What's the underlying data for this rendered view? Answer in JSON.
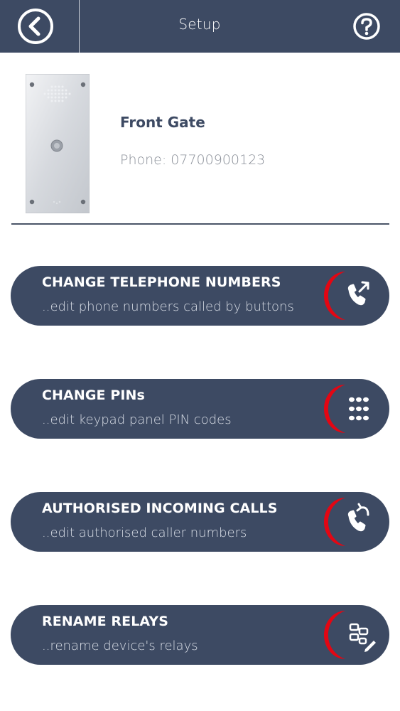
{
  "header": {
    "title": "Setup"
  },
  "device": {
    "name": "Front Gate",
    "phone": "Phone: 07700900123"
  },
  "menu": [
    {
      "title": "CHANGE TELEPHONE NUMBERS",
      "subtitle": "..edit phone numbers called by buttons",
      "icon": "phone-forward-icon"
    },
    {
      "title": "CHANGE PINs",
      "subtitle": "..edit keypad panel PIN codes",
      "icon": "keypad-icon"
    },
    {
      "title": "AUTHORISED INCOMING CALLS",
      "subtitle": "..edit authorised caller numbers",
      "icon": "phone-incoming-icon"
    },
    {
      "title": "RENAME RELAYS",
      "subtitle": "..rename device's relays",
      "icon": "relay-edit-icon"
    }
  ],
  "colors": {
    "header": "#3d4a63",
    "accent": "#e30613",
    "button": "#3d4a63"
  }
}
